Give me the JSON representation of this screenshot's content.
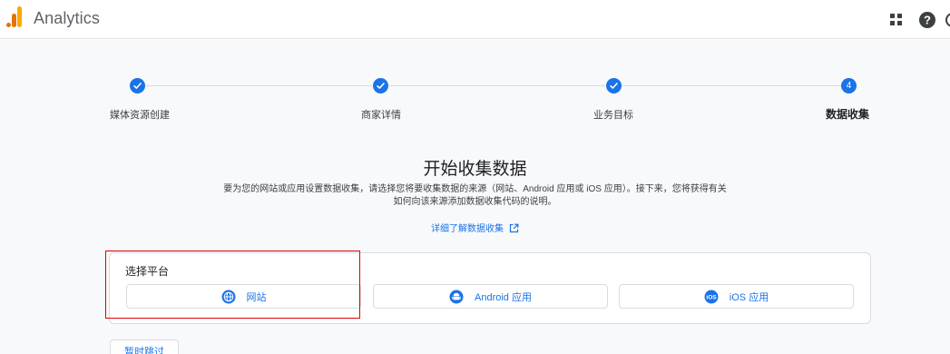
{
  "header": {
    "app_title": "Analytics",
    "icons": [
      "analytics-logo",
      "apps-grid-icon",
      "help-icon",
      "account-icon"
    ],
    "logo_colors": [
      "#f9ab00",
      "#e37400",
      "#e37400"
    ]
  },
  "stepper": {
    "steps": [
      {
        "label": "媒体资源创建",
        "state": "complete"
      },
      {
        "label": "商家详情",
        "state": "complete"
      },
      {
        "label": "业务目标",
        "state": "complete"
      },
      {
        "label": "数据收集",
        "state": "active",
        "number": "4"
      }
    ]
  },
  "intro": {
    "title": "开始收集数据",
    "description_line1": "要为您的网站或应用设置数据收集，请选择您将要收集数据的来源（网站、Android 应用或 iOS 应用）。接下来，您将获得有关",
    "description_line2": "如何向该来源添加数据收集代码的说明。",
    "learn_more": "详细了解数据收集"
  },
  "platform_card": {
    "title": "选择平台",
    "options": [
      {
        "label": "网站",
        "icon": "globe-icon"
      },
      {
        "label": "Android 应用",
        "icon": "android-icon"
      },
      {
        "label": "iOS 应用",
        "icon": "ios-icon"
      }
    ]
  },
  "skip_label": "暂时跳过",
  "colors": {
    "accent": "#1a73e8",
    "highlight": "#e00000",
    "background": "#f8f9fa"
  }
}
